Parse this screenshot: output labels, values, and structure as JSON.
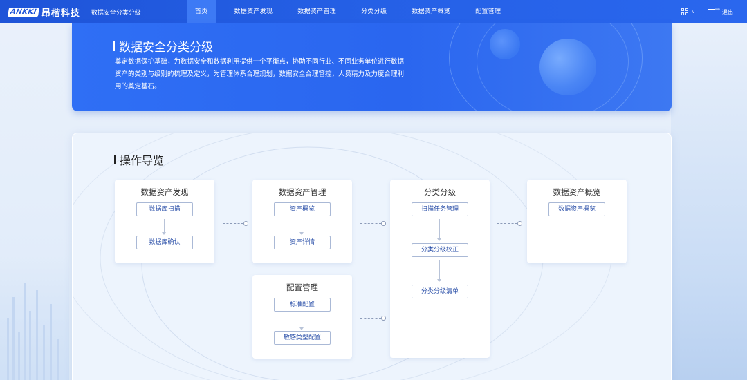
{
  "header": {
    "logo_mark": "ANKKI",
    "logo_text": "昂楷科技",
    "app_name": "数据安全分类分级",
    "nav": [
      {
        "label": "首页",
        "active": true
      },
      {
        "label": "数据资产发现",
        "active": false
      },
      {
        "label": "数据资产管理",
        "active": false
      },
      {
        "label": "分类分级",
        "active": false
      },
      {
        "label": "数据资产概览",
        "active": false
      },
      {
        "label": "配置管理",
        "active": false
      }
    ],
    "apps_icon": "grid-icon",
    "logout_label": "退出",
    "accent_color": "#2560e6"
  },
  "hero": {
    "title": "数据安全分类分级",
    "description": "奠定数据保护基础，为数据安全和数据利用提供一个平衡点，协助不同行业、不同业务单位进行数据资产的类别与级别的梳理及定义，为管理体系合理规划，数据安全合理管控，人员精力及力度合理利用的奠定基石。"
  },
  "guide": {
    "title": "操作导览",
    "cards": [
      {
        "title": "数据资产发现",
        "steps": [
          "数据库扫描",
          "数据库确认"
        ]
      },
      {
        "title": "数据资产管理",
        "steps": [
          "资产概览",
          "资产详情"
        ]
      },
      {
        "title": "分类分级",
        "steps": [
          "扫描任务管理",
          "分类分级校正",
          "分类分级清单"
        ]
      },
      {
        "title": "数据资产概览",
        "steps": [
          "数据资产概览"
        ]
      },
      {
        "title": "配置管理",
        "steps": [
          "标准配置",
          "敏感类型配置"
        ]
      }
    ]
  }
}
